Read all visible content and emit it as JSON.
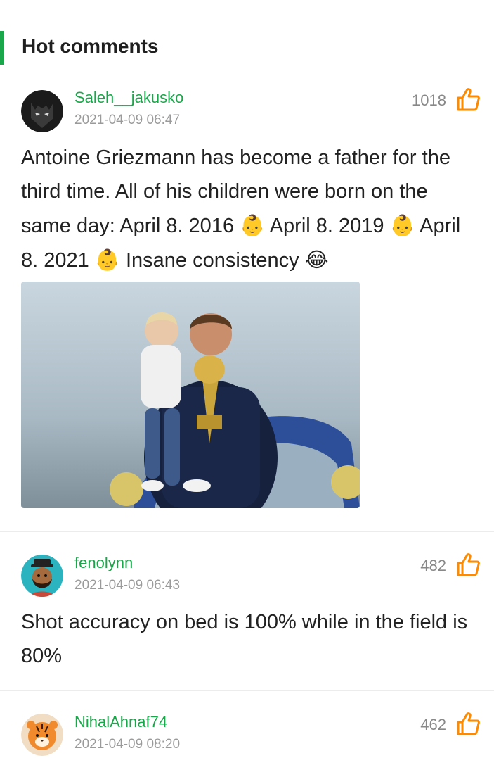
{
  "section": {
    "title": "Hot comments"
  },
  "colors": {
    "accent": "#1aa64a",
    "like": "#ff8a00",
    "meta": "#9a9a9a"
  },
  "comments": [
    {
      "username": "Saleh__jakusko",
      "timestamp": "2021-04-09 06:47",
      "likes": "1018",
      "avatar_icon": "batman-mask-avatar",
      "text_parts": [
        "Antoine Griezmann has become a father for the third time. All of his children were born on the same day: April 8. 2016 ",
        "👶",
        " April 8. 2019 ",
        "👶",
        " April 8. 2021 ",
        "👶",
        " Insane consistency ",
        "😂"
      ]
    },
    {
      "username": "fenolynn",
      "timestamp": "2021-04-09 06:43",
      "likes": "482",
      "avatar_icon": "bearded-man-hat-avatar",
      "text": "Shot accuracy on bed is 100% while in the field is 80%"
    },
    {
      "username": "NihalAhnaf74",
      "timestamp": "2021-04-09 08:20",
      "likes": "462",
      "avatar_icon": "tiger-avatar"
    }
  ]
}
